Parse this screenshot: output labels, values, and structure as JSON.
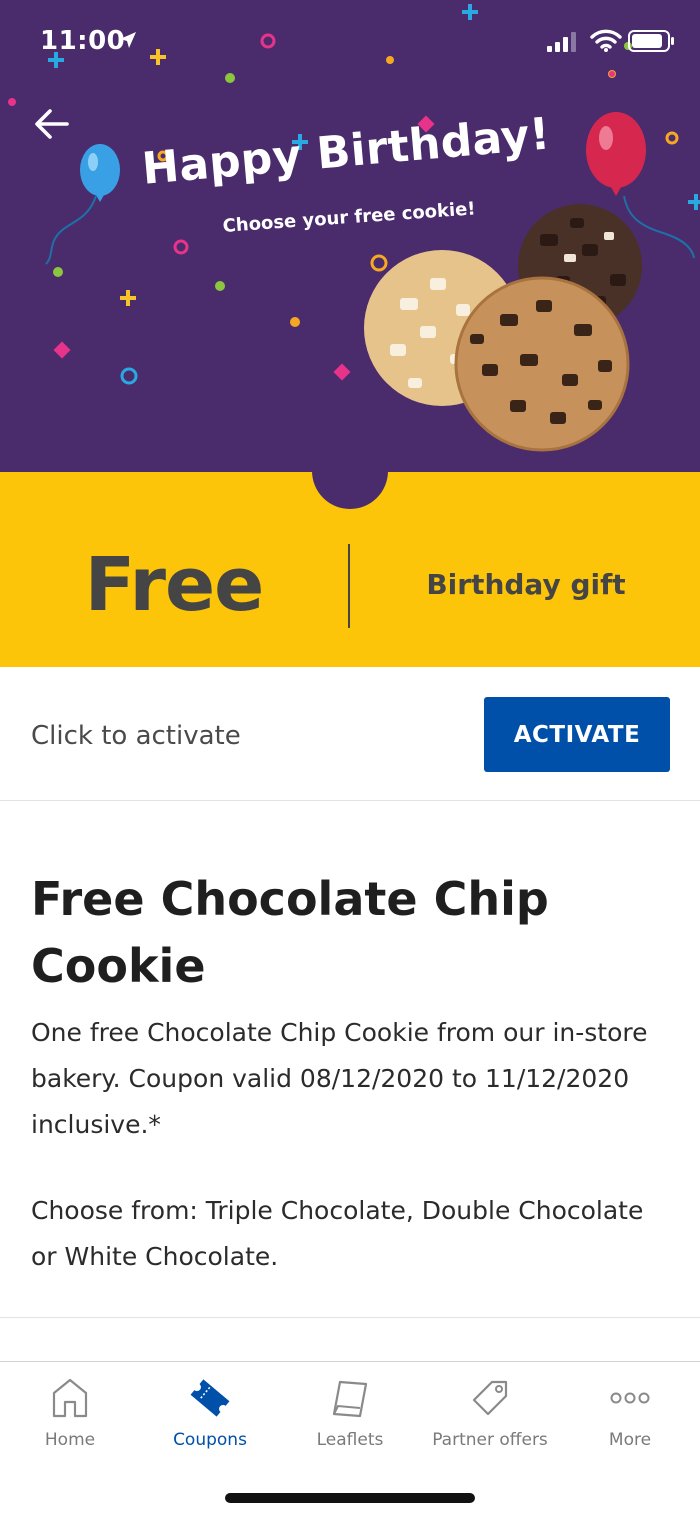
{
  "status_bar": {
    "time": "11:00"
  },
  "hero": {
    "title": "Happy Birthday!",
    "subtitle": "Choose your free cookie!",
    "background_color": "#4a2c6c"
  },
  "offer": {
    "value": "Free",
    "label": "Birthday gift",
    "band_color": "#fcc50a"
  },
  "activation": {
    "hint": "Click to activate",
    "button_label": "ACTIVATE",
    "button_color": "#0050aa"
  },
  "coupon": {
    "title": "Free Chocolate Chip Cookie",
    "description": "One free Chocolate Chip Cookie from our in-store bakery. Coupon valid 08/12/2020 to 11/12/2020 inclusive.*",
    "choose": "Choose from: Triple Chocolate, Double Chocolate or White Chocolate."
  },
  "tabbar": {
    "active": "Coupons",
    "items": [
      {
        "label": "Home",
        "icon": "home-icon"
      },
      {
        "label": "Coupons",
        "icon": "ticket-icon"
      },
      {
        "label": "Leaflets",
        "icon": "leaflet-icon"
      },
      {
        "label": "Partner offers",
        "icon": "tag-icon"
      },
      {
        "label": "More",
        "icon": "more-dots-icon"
      }
    ]
  }
}
